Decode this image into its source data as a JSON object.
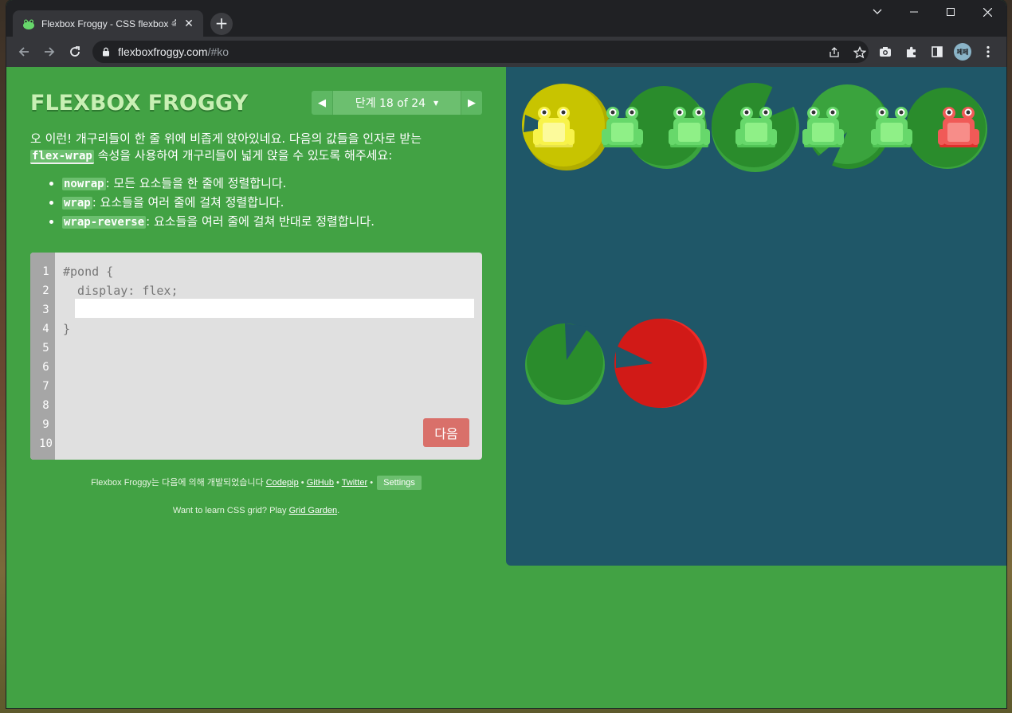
{
  "browser": {
    "tab_title": "Flexbox Froggy - CSS flexbox 속",
    "new_tab": "+",
    "url_host": "flexboxfroggy.com",
    "url_path": "/#ko",
    "profile_initials": "페페"
  },
  "header": {
    "logo": "FLEXBOX FROGGY",
    "prev_arrow": "◀",
    "next_arrow": "▶",
    "level_label": "단계 18 of 24",
    "level_caret": "▼"
  },
  "instructions": {
    "intro": "오 이런! 개구리들이 한 줄 위에 비좁게 앉아있네요. 다음의 값들을 인자로 받는",
    "property": "flex-wrap",
    "intro_end": "속성을 사용하여 개구리들이 넓게 앉을 수 있도록 해주세요:",
    "options": [
      {
        "code": "nowrap",
        "desc": ": 모든 요소들을 한 줄에 정렬합니다."
      },
      {
        "code": "wrap",
        "desc": ": 요소들을 여러 줄에 걸쳐 정렬합니다."
      },
      {
        "code": "wrap-reverse",
        "desc": ": 요소들을 여러 줄에 걸쳐 반대로 정렬합니다."
      }
    ]
  },
  "editor": {
    "line_numbers": [
      "1",
      "2",
      "3",
      "4",
      "5",
      "6",
      "7",
      "8",
      "9",
      "10"
    ],
    "lines": [
      "#pond {",
      "  display: flex;",
      "",
      "}"
    ],
    "input_value": "",
    "next_button": "다음"
  },
  "footer": {
    "credits_prefix": "Flexbox Froggy는 다음에 의해 개발되었습니다",
    "link_codepip": "Codepip",
    "sep": "•",
    "link_github": "GitHub",
    "link_twitter": "Twitter",
    "settings_button": "Settings",
    "grid_prefix": "Want to learn CSS grid? Play",
    "grid_link": "Grid Garden",
    "grid_suffix": "."
  },
  "colors": {
    "page_bg": "#42a244",
    "pond_bg": "#1f5768",
    "lilypad_green": "#2a8c2c",
    "lilypad_yellow": "#c8c400",
    "lilypad_red": "#d11a17",
    "frog_green": "#67d86b",
    "frog_yellow": "#f8f34a",
    "frog_red": "#f05a57"
  }
}
